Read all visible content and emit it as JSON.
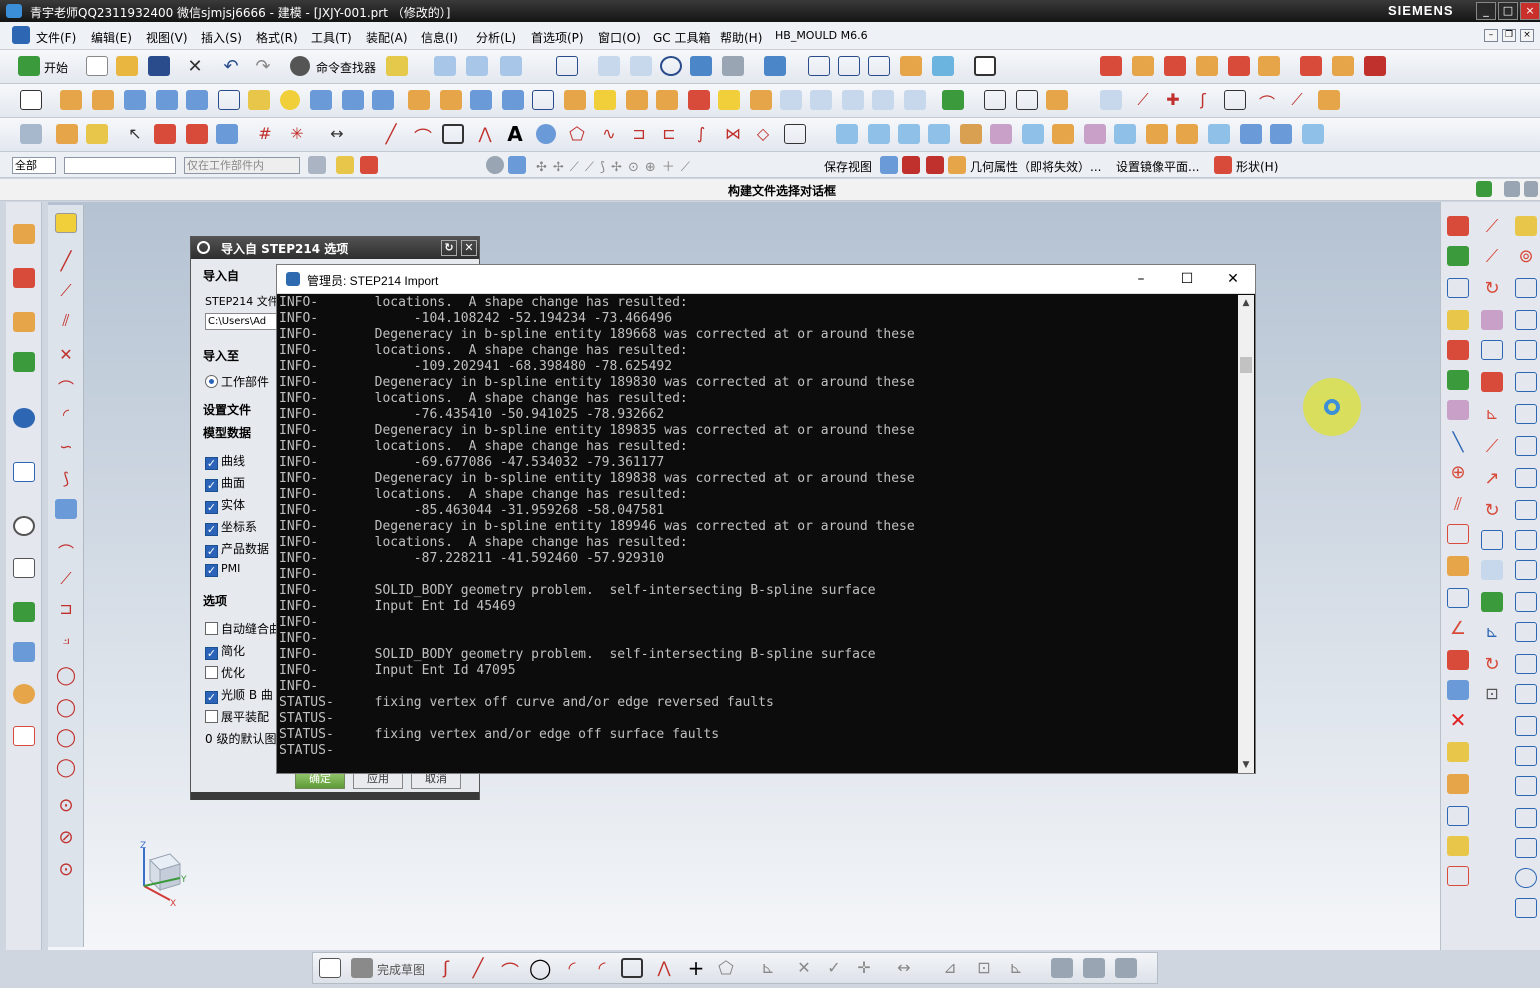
{
  "window": {
    "title": "青宇老师QQ2311932400 微信sjmjsj6666 - 建模 - [JXJY-001.prt （修改的）]",
    "brand": "SIEMENS",
    "controls": [
      "_",
      "□",
      "×"
    ]
  },
  "menubar": {
    "items": [
      "文件(F)",
      "编辑(E)",
      "视图(V)",
      "插入(S)",
      "格式(R)",
      "工具(T)",
      "装配(A)",
      "信息(I)",
      "分析(L)",
      "首选项(P)",
      "窗口(O)",
      "GC 工具箱",
      "帮助(H)",
      "HB_MOULD M6.6"
    ]
  },
  "toolbar": {
    "start_label": "开始",
    "command_finder": "命令查找器"
  },
  "filterbar": {
    "type_filter": "全部",
    "scope": "仅在工作部件内",
    "save_view": "保存视图",
    "geom_props": "几何属性（即将失效）...",
    "mirror_plane": "设置镜像平面...",
    "shape": "形状(H)"
  },
  "cue_line": "构建文件选择对话框",
  "import_dialog": {
    "title": "导入自 STEP214 选项",
    "sections": {
      "import_from": "导入自",
      "import_to": "导入至",
      "settings_file": "设置文件",
      "model_data": "模型数据",
      "options": "选项"
    },
    "file_label": "STEP214 文件",
    "file_path": "C:\\Users\\Ad",
    "work_part": "工作部件",
    "model_checkboxes": [
      {
        "label": "曲线",
        "checked": true
      },
      {
        "label": "曲面",
        "checked": true
      },
      {
        "label": "实体",
        "checked": true
      },
      {
        "label": "坐标系",
        "checked": true
      },
      {
        "label": "产品数据",
        "checked": true
      },
      {
        "label": "PMI",
        "checked": true
      }
    ],
    "option_checkboxes": [
      {
        "label": "自动缝合曲",
        "checked": false
      },
      {
        "label": "简化",
        "checked": true
      },
      {
        "label": "优化",
        "checked": false
      },
      {
        "label": "光顺 B 曲",
        "checked": true
      },
      {
        "label": "展平装配",
        "checked": false
      }
    ],
    "default_layer": "0 级的默认图",
    "buttons": [
      "确定",
      "应用",
      "取消"
    ]
  },
  "console": {
    "title": "管理员:  STEP214 Import",
    "lines": [
      {
        "p": "INFO-",
        "t": "  locations.  A shape change has resulted:"
      },
      {
        "p": "INFO-",
        "t": "       -104.108242 -52.194234 -73.466496"
      },
      {
        "p": "INFO-",
        "t": "  Degeneracy in b-spline entity 189668 was corrected at or around these"
      },
      {
        "p": "INFO-",
        "t": "  locations.  A shape change has resulted:"
      },
      {
        "p": "INFO-",
        "t": "       -109.202941 -68.398480 -78.625492"
      },
      {
        "p": "INFO-",
        "t": "  Degeneracy in b-spline entity 189830 was corrected at or around these"
      },
      {
        "p": "INFO-",
        "t": "  locations.  A shape change has resulted:"
      },
      {
        "p": "INFO-",
        "t": "       -76.435410 -50.941025 -78.932662"
      },
      {
        "p": "INFO-",
        "t": "  Degeneracy in b-spline entity 189835 was corrected at or around these"
      },
      {
        "p": "INFO-",
        "t": "  locations.  A shape change has resulted:"
      },
      {
        "p": "INFO-",
        "t": "       -69.677086 -47.534032 -79.361177"
      },
      {
        "p": "INFO-",
        "t": "  Degeneracy in b-spline entity 189838 was corrected at or around these"
      },
      {
        "p": "INFO-",
        "t": "  locations.  A shape change has resulted:"
      },
      {
        "p": "INFO-",
        "t": "       -85.463044 -31.959268 -58.047581"
      },
      {
        "p": "INFO-",
        "t": "  Degeneracy in b-spline entity 189946 was corrected at or around these"
      },
      {
        "p": "INFO-",
        "t": "  locations.  A shape change has resulted:"
      },
      {
        "p": "INFO-",
        "t": "       -87.228211 -41.592460 -57.929310"
      },
      {
        "p": "INFO-",
        "t": ""
      },
      {
        "p": "INFO-",
        "t": "  SOLID_BODY geometry problem.  self-intersecting B-spline surface"
      },
      {
        "p": "INFO-",
        "t": "  Input Ent Id 45469"
      },
      {
        "p": "INFO-",
        "t": ""
      },
      {
        "p": "INFO-",
        "t": ""
      },
      {
        "p": "INFO-",
        "t": "  SOLID_BODY geometry problem.  self-intersecting B-spline surface"
      },
      {
        "p": "INFO-",
        "t": "  Input Ent Id 47095"
      },
      {
        "p": "INFO-",
        "t": ""
      },
      {
        "p": "STATUS-",
        "t": "  fixing vertex off curve and/or edge reversed faults"
      },
      {
        "p": "STATUS-",
        "t": ""
      },
      {
        "p": "STATUS-",
        "t": "  fixing vertex and/or edge off surface faults"
      },
      {
        "p": "STATUS-",
        "t": ""
      }
    ]
  },
  "sketch_bar": {
    "finish_label": "完成草图"
  },
  "triad": {
    "x": "X",
    "y": "Y",
    "z": "Z"
  }
}
